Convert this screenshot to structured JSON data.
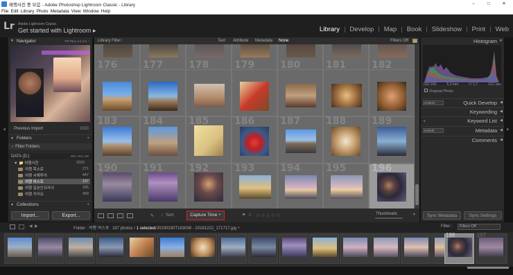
{
  "window": {
    "title": "매행사진 중 모음 - Adobe Photoshop Lightroom Classic - Library"
  },
  "menu": [
    "File",
    "Edit",
    "Library",
    "Photo",
    "Metadata",
    "View",
    "Window",
    "Help"
  ],
  "identity": {
    "logo": "Lr",
    "line1": "Adobe Lightroom Classic",
    "line2": "Get started with Lightroom ▸"
  },
  "modules": [
    "Library",
    "Develop",
    "Map",
    "Book",
    "Slideshow",
    "Print",
    "Web"
  ],
  "left_panel": {
    "navigator": {
      "title": "Navigator",
      "zoom": "FIT   FILL   1:1   3:1 ÷"
    },
    "catalog": {
      "label": "Previous Import",
      "count": "1593"
    },
    "folders": {
      "title": "Folders",
      "filter": "Filter Folders",
      "volume": "DATA (D:)",
      "volume_size": "400 / 931 GB",
      "items": [
        {
          "name": "▼ 📁 여행사진",
          "count": "1593"
        },
        {
          "name": "여행 목소료",
          "count": "271"
        },
        {
          "name": "여행 서해투어",
          "count": "447"
        },
        {
          "name": "여행 여스로",
          "count": "197"
        },
        {
          "name": "여행 일본안프라이",
          "count": "185"
        },
        {
          "name": "여행 카리요",
          "count": "499"
        }
      ]
    },
    "collections": {
      "title": "Collections"
    },
    "import_button": "Import...",
    "export_button": "Export..."
  },
  "filter_bar": {
    "label": "Library Filter :",
    "options": [
      "Text",
      "Attribute",
      "Metadata",
      "None"
    ],
    "custom": "Filters Off"
  },
  "grid": {
    "rows": [
      [
        "176",
        "177",
        "178",
        "179",
        "180",
        "181",
        "182"
      ],
      [
        "183",
        "184",
        "185",
        "186",
        "187",
        "188",
        "189"
      ],
      [
        "190",
        "191",
        "192",
        "193",
        "194",
        "195",
        "196"
      ]
    ],
    "selected": "196"
  },
  "toolbar": {
    "sort_label": "Sort:",
    "sort_value": "Capture Time ÷",
    "rating": "☆☆☆☆☆",
    "thumbs_label": "Thumbnails"
  },
  "right_panel": {
    "histogram_title": "Histogram",
    "exif": [
      "ISO 160",
      "5.2 mm",
      "f / 1.7",
      "1/17 sec"
    ],
    "original_photo": "Original Photo",
    "quick_develop_preset": "Custom",
    "quick_develop": "Quick Develop",
    "keywording": "Keywording",
    "keyword_list": "Keyword List",
    "metadata_preset": "Default",
    "metadata": "Metadata",
    "comments": "Comments",
    "sync_metadata": "Sync Metadata",
    "sync_settings": "Sync Settings"
  },
  "filmstrip": {
    "folder_label": "Folder : ",
    "folder_name": "여행 여스로",
    "count": "197 photos / ",
    "selected": "1 selected",
    "file": "/20200330T163038 - 20181222_171717.jpg ÷",
    "filter_label": "Filter :",
    "filter_value": "Filters Off",
    "numbers": [
      "",
      "",
      "",
      "",
      "",
      "",
      "",
      "",
      "",
      "",
      "",
      "",
      "",
      "",
      "",
      "",
      "196",
      "197"
    ]
  },
  "colors": {
    "accent_red": "#e02020",
    "bg_dark": "#151515",
    "panel": "#2a2a2a",
    "grid_bg": "#5e5e5e"
  }
}
